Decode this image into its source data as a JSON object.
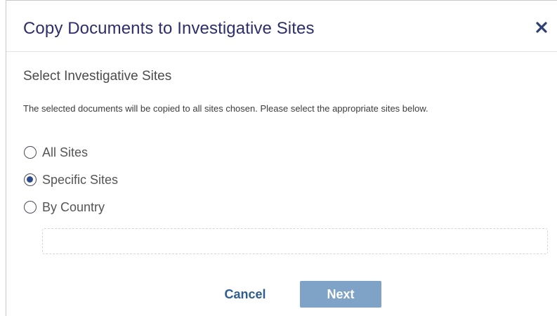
{
  "dialog": {
    "title": "Copy Documents to Investigative Sites",
    "close_icon": "close-icon",
    "section_heading": "Select Investigative Sites",
    "description": "The selected documents will be copied to all sites chosen. Please select the appropriate sites below.",
    "options": [
      {
        "label": "All Sites",
        "selected": false
      },
      {
        "label": "Specific Sites",
        "selected": true
      },
      {
        "label": "By Country",
        "selected": false
      }
    ],
    "selection_box_value": "",
    "buttons": {
      "cancel": "Cancel",
      "next": "Next"
    }
  },
  "colors": {
    "title": "#2d2e6b",
    "close_icon": "#2d3f73",
    "link": "#2e5d91",
    "primary_button_disabled": "#7ea3c7"
  }
}
